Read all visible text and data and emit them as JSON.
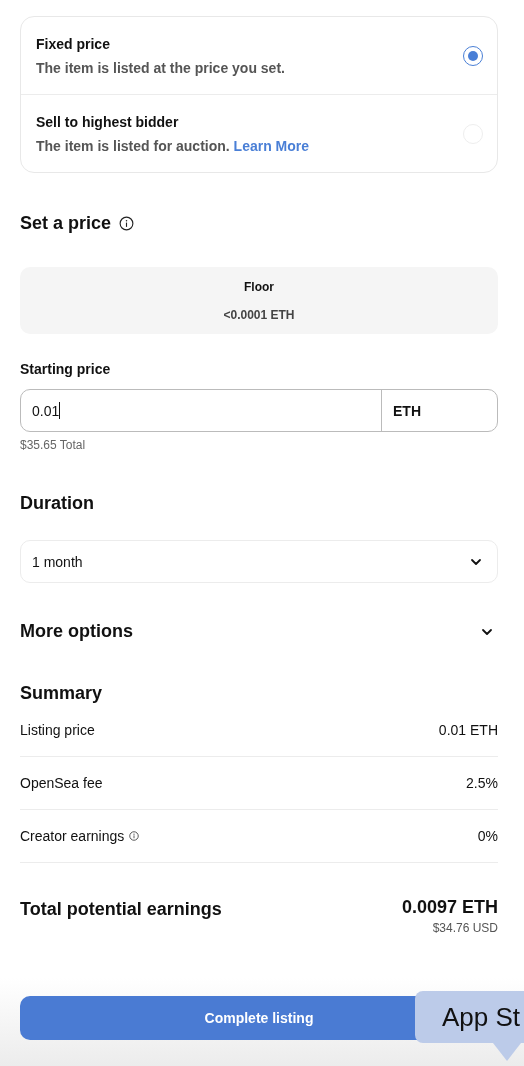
{
  "sale_types": [
    {
      "title": "Fixed price",
      "description": "The item is listed at the price you set.",
      "selected": true
    },
    {
      "title": "Sell to highest bidder",
      "description": "The item is listed for auction.",
      "link": "Learn More",
      "selected": false
    }
  ],
  "set_price": {
    "heading": "Set a price",
    "floor": {
      "label": "Floor",
      "value": "<0.0001 ETH"
    }
  },
  "starting_price": {
    "label": "Starting price",
    "value": "0.01",
    "currency": "ETH",
    "total": "$35.65 Total"
  },
  "duration": {
    "heading": "Duration",
    "value": "1 month"
  },
  "more_options": {
    "label": "More options",
    "expanded": false
  },
  "summary": {
    "heading": "Summary",
    "rows": [
      {
        "label": "Listing price",
        "value": "0.01 ETH",
        "info": false
      },
      {
        "label": "OpenSea fee",
        "value": "2.5%",
        "info": false
      },
      {
        "label": "Creator earnings",
        "value": "0%",
        "info": true
      }
    ],
    "total": {
      "label": "Total potential earnings",
      "value": "0.0097 ETH",
      "usd": "$34.76 USD"
    }
  },
  "button": "Complete listing",
  "tooltip": "App St"
}
